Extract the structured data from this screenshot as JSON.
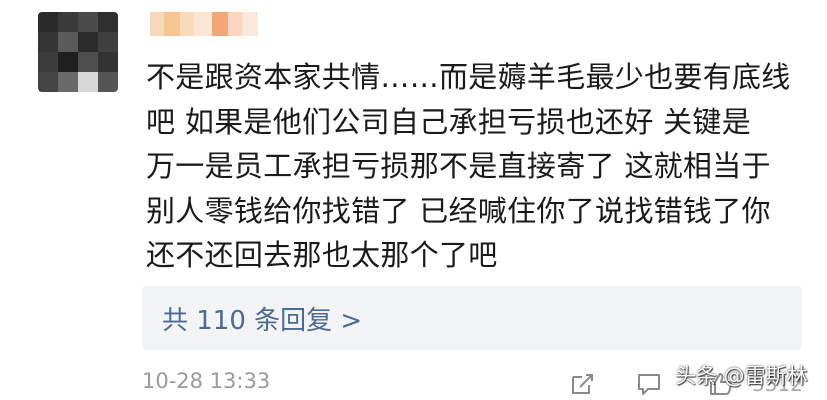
{
  "comment": {
    "lines": [
      "不是跟资本家共情……而是薅羊毛最少也要有底线",
      "吧  如果是他们公司自己承担亏损也还好  关键是",
      "万一是员工承担亏损那不是直接寄了  这就相当于",
      "别人零钱给你找错了  已经喊住你了说找错钱了你",
      "还不还回去那也太那个了吧"
    ],
    "replies_label": "共 110 条回复 >",
    "timestamp": "10-28 13:33",
    "like_count": "3312"
  },
  "watermark": "头条 @雷斯林",
  "icons": {
    "share": "share-icon",
    "comment": "comment-icon",
    "like": "like-icon"
  },
  "colors": {
    "link": "#4d6a93",
    "timestamp": "#9b9b9b",
    "replies_bg": "#f3f4f6",
    "text": "#1a1a1a"
  }
}
